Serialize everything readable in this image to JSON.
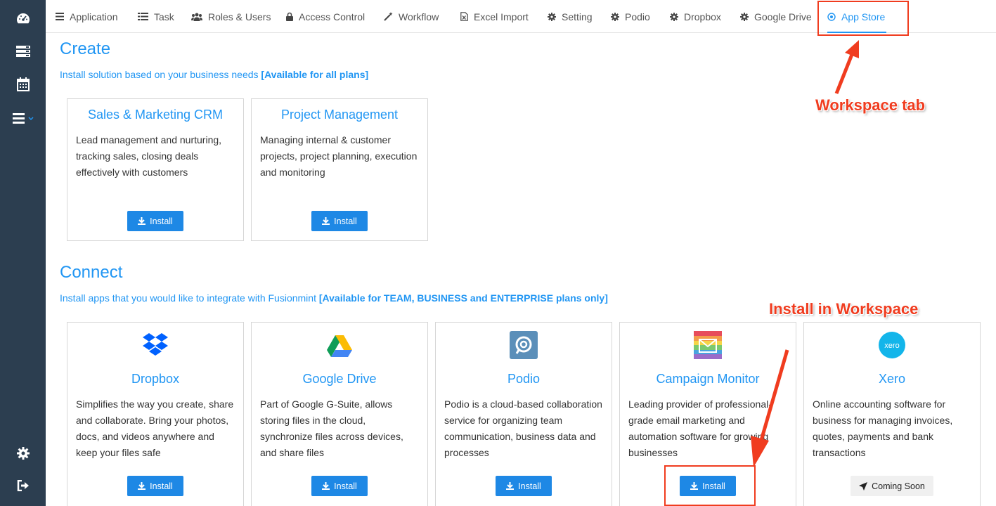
{
  "nav": {
    "tabs": [
      {
        "label": "Application",
        "icon": "list-icon"
      },
      {
        "label": "Task",
        "icon": "task-list-icon"
      },
      {
        "label": "Roles & Users",
        "icon": "users-icon"
      },
      {
        "label": "Access Control",
        "icon": "lock-icon"
      },
      {
        "label": "Workflow",
        "icon": "magic-wand-icon"
      },
      {
        "label": "Excel Import",
        "icon": "excel-file-icon"
      },
      {
        "label": "Setting",
        "icon": "gear-icon"
      },
      {
        "label": "Podio",
        "icon": "gear-icon"
      },
      {
        "label": "Dropbox",
        "icon": "gear-icon"
      },
      {
        "label": "Google Drive",
        "icon": "gear-icon"
      },
      {
        "label": "App Store",
        "icon": "target-icon"
      }
    ],
    "active_tab": "App Store"
  },
  "sidebar": {
    "icons": [
      "dashboard-icon",
      "server-icon",
      "calendar-icon",
      "menu-icon",
      "gear-icon",
      "sign-out-icon"
    ]
  },
  "create": {
    "title": "Create",
    "desc": "Install solution based on your business needs ",
    "desc_bold": "[Available for all plans]",
    "cards": [
      {
        "title": "Sales & Marketing CRM",
        "text": "Lead management and nurturing, tracking sales, closing deals effectively with customers",
        "button": "Install"
      },
      {
        "title": "Project Management",
        "text": "Managing internal & customer projects, project planning, execution and monitoring",
        "button": "Install"
      }
    ]
  },
  "connect": {
    "title": "Connect",
    "desc": "Install apps that you would like to integrate with Fusionmint ",
    "desc_bold": "[Available for TEAM, BUSINESS and ENTERPRISE plans only]",
    "cards": [
      {
        "title": "Dropbox",
        "logo": "dropbox-logo-icon",
        "text": "Simplifies the way you create, share and collaborate. Bring your photos, docs, and videos anywhere and keep your files safe",
        "button": "Install"
      },
      {
        "title": "Google Drive",
        "logo": "google-drive-logo-icon",
        "text": "Part of Google G-Suite, allows storing files in the cloud, synchronize files across devices, and share files",
        "button": "Install"
      },
      {
        "title": "Podio",
        "logo": "podio-logo-icon",
        "text": "Podio is a cloud-based collaboration service for organizing team communication, business data and processes",
        "button": "Install"
      },
      {
        "title": "Campaign Monitor",
        "logo": "campaign-monitor-logo-icon",
        "text": "Leading provider of professional-grade email marketing and automation software for growing businesses",
        "button": "Install"
      },
      {
        "title": "Xero",
        "logo": "xero-logo-icon",
        "logo_text": "xero",
        "text": "Online accounting software for business for managing invoices, quotes, payments and bank transactions",
        "button": "Coming Soon"
      }
    ]
  },
  "annotations": {
    "workspace_tab": "Workspace tab",
    "install_workspace": "Install in Workspace"
  },
  "colors": {
    "accent": "#2196f3",
    "sidebar": "#2c3e50",
    "button": "#1e88e5",
    "annotation": "#f03c1f"
  }
}
